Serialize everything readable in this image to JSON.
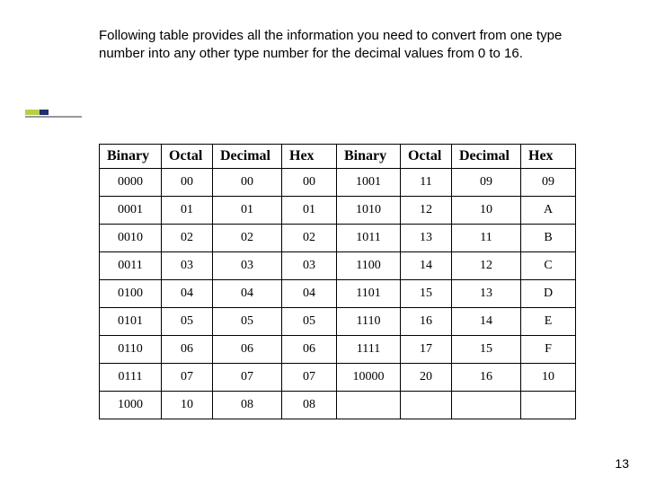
{
  "intro_text": "Following table provides all the information you need to convert from one type number into any other type number for the decimal values from 0 to 16.",
  "headers": [
    "Binary",
    "Octal",
    "Decimal",
    "Hex",
    "Binary",
    "Octal",
    "Decimal",
    "Hex"
  ],
  "rows": [
    [
      "0000",
      "00",
      "00",
      "00",
      "1001",
      "11",
      "09",
      "09"
    ],
    [
      "0001",
      "01",
      "01",
      "01",
      "1010",
      "12",
      "10",
      "A"
    ],
    [
      "0010",
      "02",
      "02",
      "02",
      "1011",
      "13",
      "11",
      "B"
    ],
    [
      "0011",
      "03",
      "03",
      "03",
      "1100",
      "14",
      "12",
      "C"
    ],
    [
      "0100",
      "04",
      "04",
      "04",
      "1101",
      "15",
      "13",
      "D"
    ],
    [
      "0101",
      "05",
      "05",
      "05",
      "1110",
      "16",
      "14",
      "E"
    ],
    [
      "0110",
      "06",
      "06",
      "06",
      "1111",
      "17",
      "15",
      "F"
    ],
    [
      "0111",
      "07",
      "07",
      "07",
      "10000",
      "20",
      "16",
      "10"
    ],
    [
      "1000",
      "10",
      "08",
      "08",
      "",
      "",
      "",
      ""
    ]
  ],
  "page_number": "13",
  "chart_data": {
    "type": "table",
    "title": "Number base conversion table for decimal values 0 to 16",
    "columns": [
      "Binary",
      "Octal",
      "Decimal",
      "Hex"
    ],
    "data": [
      {
        "Binary": "0000",
        "Octal": "00",
        "Decimal": "00",
        "Hex": "00"
      },
      {
        "Binary": "0001",
        "Octal": "01",
        "Decimal": "01",
        "Hex": "01"
      },
      {
        "Binary": "0010",
        "Octal": "02",
        "Decimal": "02",
        "Hex": "02"
      },
      {
        "Binary": "0011",
        "Octal": "03",
        "Decimal": "03",
        "Hex": "03"
      },
      {
        "Binary": "0100",
        "Octal": "04",
        "Decimal": "04",
        "Hex": "04"
      },
      {
        "Binary": "0101",
        "Octal": "05",
        "Decimal": "05",
        "Hex": "05"
      },
      {
        "Binary": "0110",
        "Octal": "06",
        "Decimal": "06",
        "Hex": "06"
      },
      {
        "Binary": "0111",
        "Octal": "07",
        "Decimal": "07",
        "Hex": "07"
      },
      {
        "Binary": "1000",
        "Octal": "10",
        "Decimal": "08",
        "Hex": "08"
      },
      {
        "Binary": "1001",
        "Octal": "11",
        "Decimal": "09",
        "Hex": "09"
      },
      {
        "Binary": "1010",
        "Octal": "12",
        "Decimal": "10",
        "Hex": "A"
      },
      {
        "Binary": "1011",
        "Octal": "13",
        "Decimal": "11",
        "Hex": "B"
      },
      {
        "Binary": "1100",
        "Octal": "14",
        "Decimal": "12",
        "Hex": "C"
      },
      {
        "Binary": "1101",
        "Octal": "15",
        "Decimal": "13",
        "Hex": "D"
      },
      {
        "Binary": "1110",
        "Octal": "16",
        "Decimal": "14",
        "Hex": "E"
      },
      {
        "Binary": "1111",
        "Octal": "17",
        "Decimal": "15",
        "Hex": "F"
      },
      {
        "Binary": "10000",
        "Octal": "20",
        "Decimal": "16",
        "Hex": "10"
      }
    ]
  }
}
